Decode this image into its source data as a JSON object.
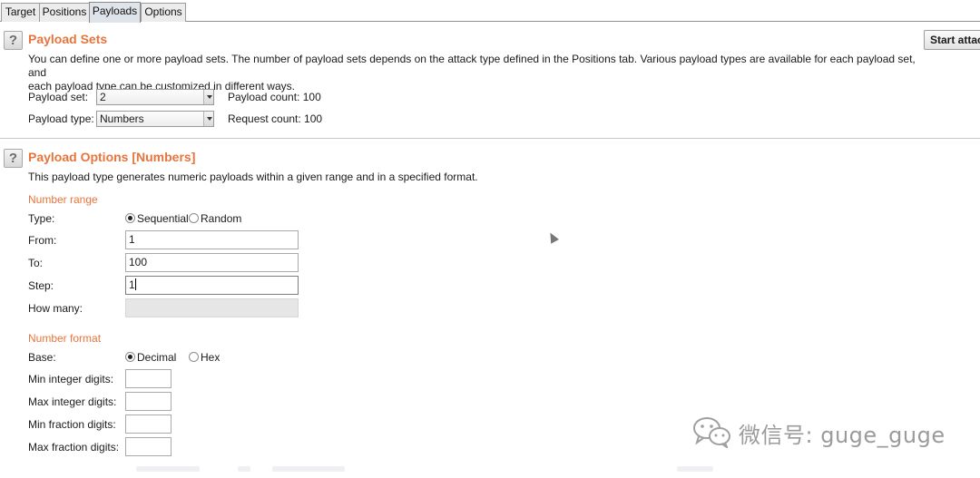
{
  "tabs": [
    "Target",
    "Positions",
    "Payloads",
    "Options"
  ],
  "start_button": "Start attack",
  "payload_sets": {
    "help": "?",
    "title": "Payload Sets",
    "description_line1": "You can define one or more payload sets. The number of payload sets depends on the attack type defined in the Positions tab. Various payload types are available for each payload set, and",
    "description_line2": "each payload type can be customized in different ways.",
    "payload_set_label": "Payload set:",
    "payload_set_value": "2",
    "payload_count": "Payload count: 100",
    "payload_type_label": "Payload type:",
    "payload_type_value": "Numbers",
    "request_count": "Request count: 100"
  },
  "payload_options": {
    "help": "?",
    "title": "Payload Options [Numbers]",
    "description": "This payload type generates numeric payloads within a given range and in a specified format.",
    "number_range": {
      "heading": "Number range",
      "type_label": "Type:",
      "sequential": "Sequential",
      "random": "Random",
      "from_label": "From:",
      "from_value": "1",
      "to_label": "To:",
      "to_value": "100",
      "step_label": "Step:",
      "step_value": "1",
      "how_many_label": "How many:"
    },
    "number_format": {
      "heading": "Number format",
      "base_label": "Base:",
      "decimal": "Decimal",
      "hex": "Hex",
      "min_int_label": "Min integer digits:",
      "max_int_label": "Max integer digits:",
      "min_frac_label": "Min fraction digits:",
      "max_frac_label": "Max fraction digits:"
    }
  },
  "watermark": "微信号: guge_guge"
}
